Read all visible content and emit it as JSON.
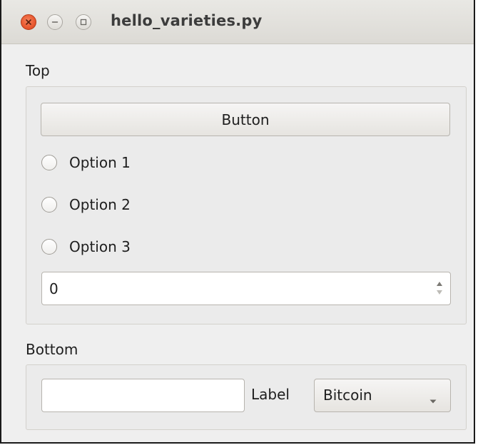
{
  "window": {
    "title": "hello_varieties.py"
  },
  "top_group": {
    "title": "Top",
    "button_label": "Button",
    "radios": [
      {
        "label": "Option 1",
        "checked": false
      },
      {
        "label": "Option 2",
        "checked": false
      },
      {
        "label": "Option 3",
        "checked": false
      }
    ],
    "spinbox_value": "0"
  },
  "bottom_group": {
    "title": "Bottom",
    "line_edit_value": "",
    "label_text": "Label",
    "combo_selected": "Bitcoin"
  },
  "icons": {
    "close": "close-icon",
    "minimize": "minimize-icon",
    "maximize": "maximize-icon",
    "spin_arrows": "spin-arrows-icon",
    "combo_arrow": "chevron-down-icon"
  },
  "colors": {
    "close_button": "#e8582f",
    "window_background": "#efefef",
    "titlebar": "#dcdad5"
  }
}
